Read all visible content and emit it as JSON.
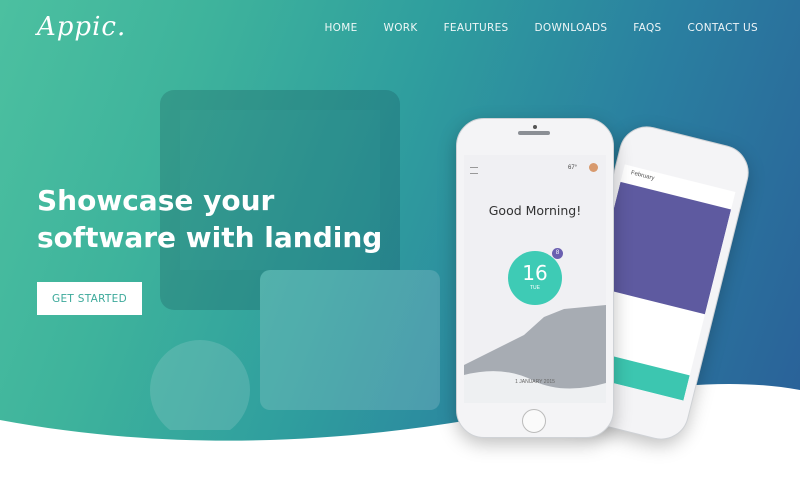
{
  "brand": {
    "logo": "Appic."
  },
  "nav": {
    "items": [
      "HOME",
      "WORK",
      "FEAUTURES",
      "DOWNLOADS",
      "FAQS",
      "CONTACT US"
    ]
  },
  "hero": {
    "headline": "Showcase your software with landing",
    "cta": "GET STARTED"
  },
  "phone_front": {
    "greeting": "Good Morning!",
    "temperature": "67°",
    "day_number": "16",
    "day_label": "TUE",
    "badge_count": "8",
    "date_text": "1 JANUARY 2015"
  },
  "phone_back": {
    "month": "February"
  },
  "colors": {
    "accent": "#3ecbb5",
    "purple": "#5e5aa0",
    "gradient_start": "#4cc0a0",
    "gradient_end": "#2a5e98"
  }
}
